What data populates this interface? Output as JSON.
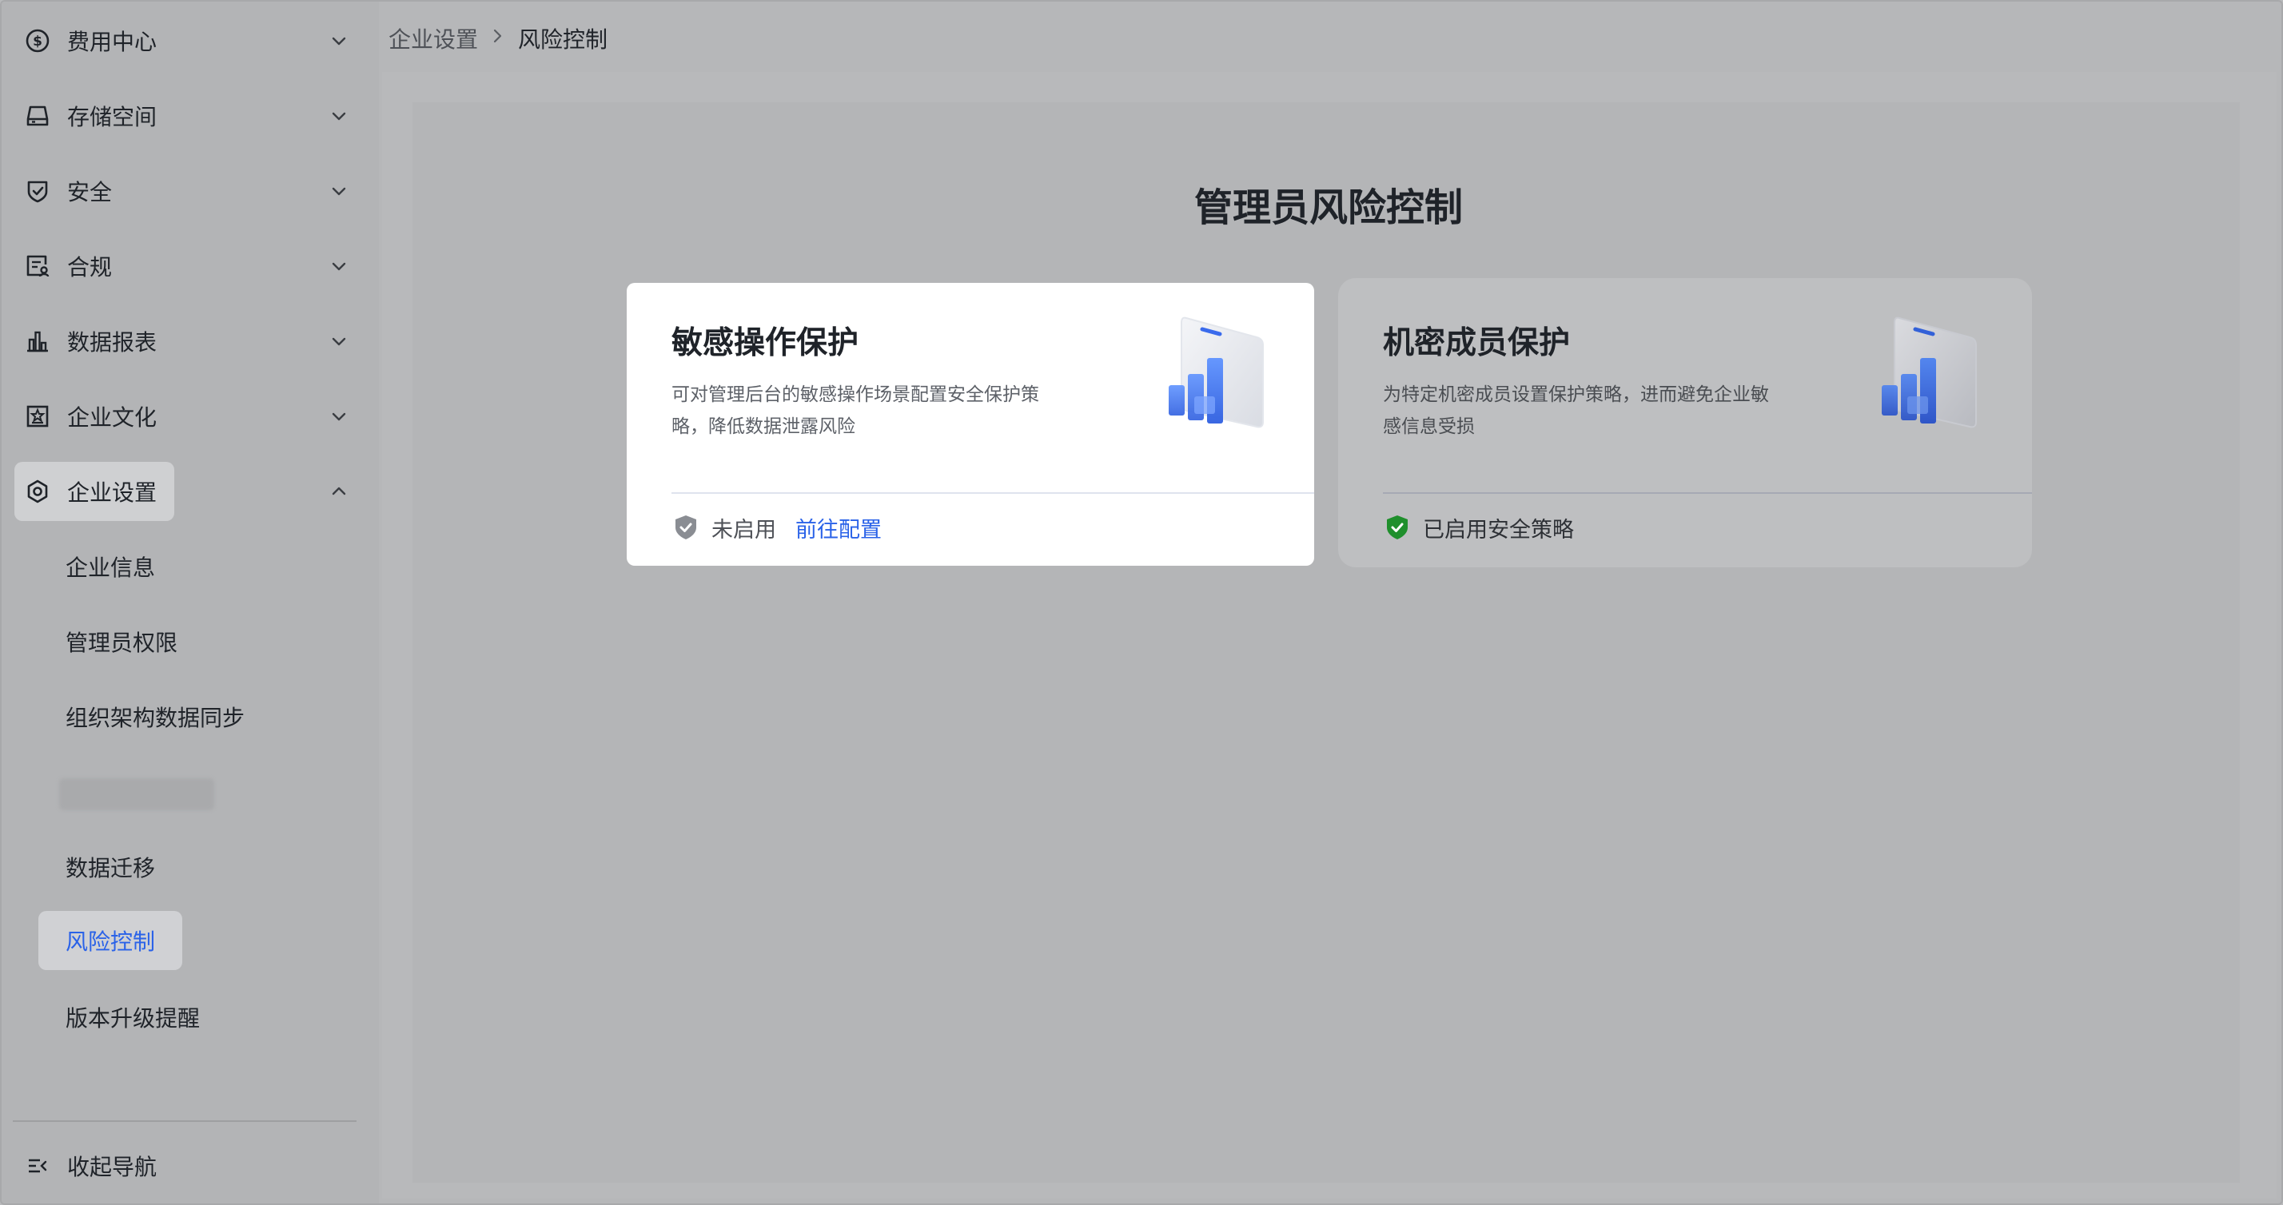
{
  "sidebar": {
    "items": [
      {
        "label": "费用中心",
        "icon": "dollar-circle-icon"
      },
      {
        "label": "存储空间",
        "icon": "storage-icon"
      },
      {
        "label": "安全",
        "icon": "shield-icon"
      },
      {
        "label": "合规",
        "icon": "compliance-icon"
      },
      {
        "label": "数据报表",
        "icon": "bar-chart-icon"
      },
      {
        "label": "企业文化",
        "icon": "culture-icon"
      },
      {
        "label": "企业设置",
        "icon": "settings-hex-icon"
      }
    ],
    "sub_items": [
      {
        "label": "企业信息"
      },
      {
        "label": "管理员权限"
      },
      {
        "label": "组织架构数据同步"
      },
      {
        "label": "数据迁移"
      },
      {
        "label": "风险控制"
      },
      {
        "label": "版本升级提醒"
      }
    ],
    "collapse_label": "收起导航"
  },
  "breadcrumb": {
    "parent": "企业设置",
    "current": "风险控制"
  },
  "page": {
    "title": "管理员风险控制"
  },
  "cards": [
    {
      "title": "敏感操作保护",
      "description": "可对管理后台的敏感操作场景配置安全保护策略，降低数据泄露风险",
      "status": "未启用",
      "action": "前往配置",
      "status_color": "#8a8d93"
    },
    {
      "title": "机密成员保护",
      "description": "为特定机密成员设置保护策略，进而避免企业敏感信息受损",
      "status": "已启用安全策略",
      "status_color": "#1f8f2c"
    }
  ],
  "colors": {
    "accent": "#2a62e8",
    "enabled": "#1f8f2c"
  }
}
